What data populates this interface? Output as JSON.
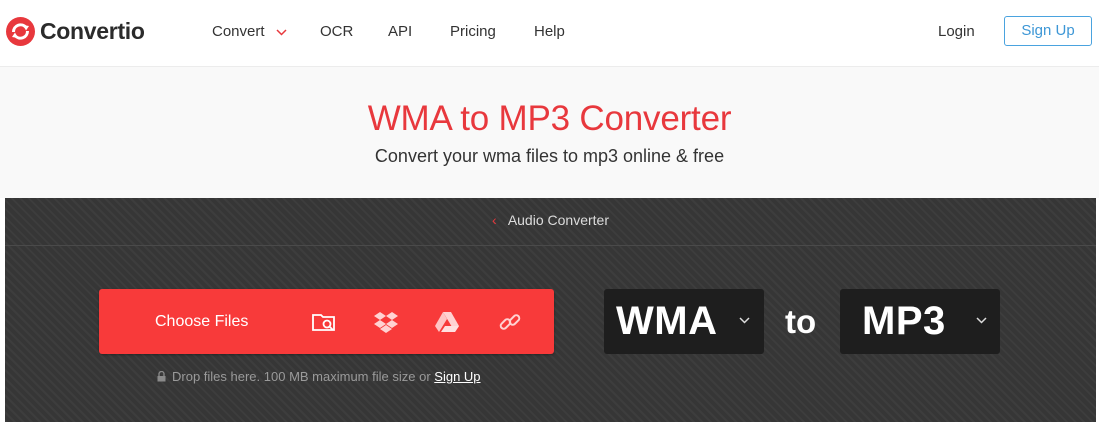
{
  "header": {
    "logo_text": "Convertio",
    "nav": [
      {
        "label": "Convert",
        "has_dropdown": true
      },
      {
        "label": "OCR"
      },
      {
        "label": "API"
      },
      {
        "label": "Pricing"
      },
      {
        "label": "Help"
      }
    ],
    "login_label": "Login",
    "signup_label": "Sign Up"
  },
  "hero": {
    "title": "WMA to MP3 Converter",
    "subtitle": "Convert your wma files to mp3 online & free"
  },
  "converter": {
    "breadcrumb": "Audio Converter",
    "choose_files_label": "Choose Files",
    "source_icons": [
      "folder-search-icon",
      "dropbox-icon",
      "google-drive-icon",
      "link-icon"
    ],
    "drop_hint": "Drop files here. 100 MB maximum file size or",
    "drop_hint_link": "Sign Up",
    "from_format": "WMA",
    "to_word": "to",
    "to_format": "MP3"
  },
  "colors": {
    "brand_red": "#e8383d",
    "button_red": "#f83a3a",
    "signup_blue": "#3d97d6",
    "panel_dark": "#363636",
    "format_box": "#1e1e1e"
  }
}
